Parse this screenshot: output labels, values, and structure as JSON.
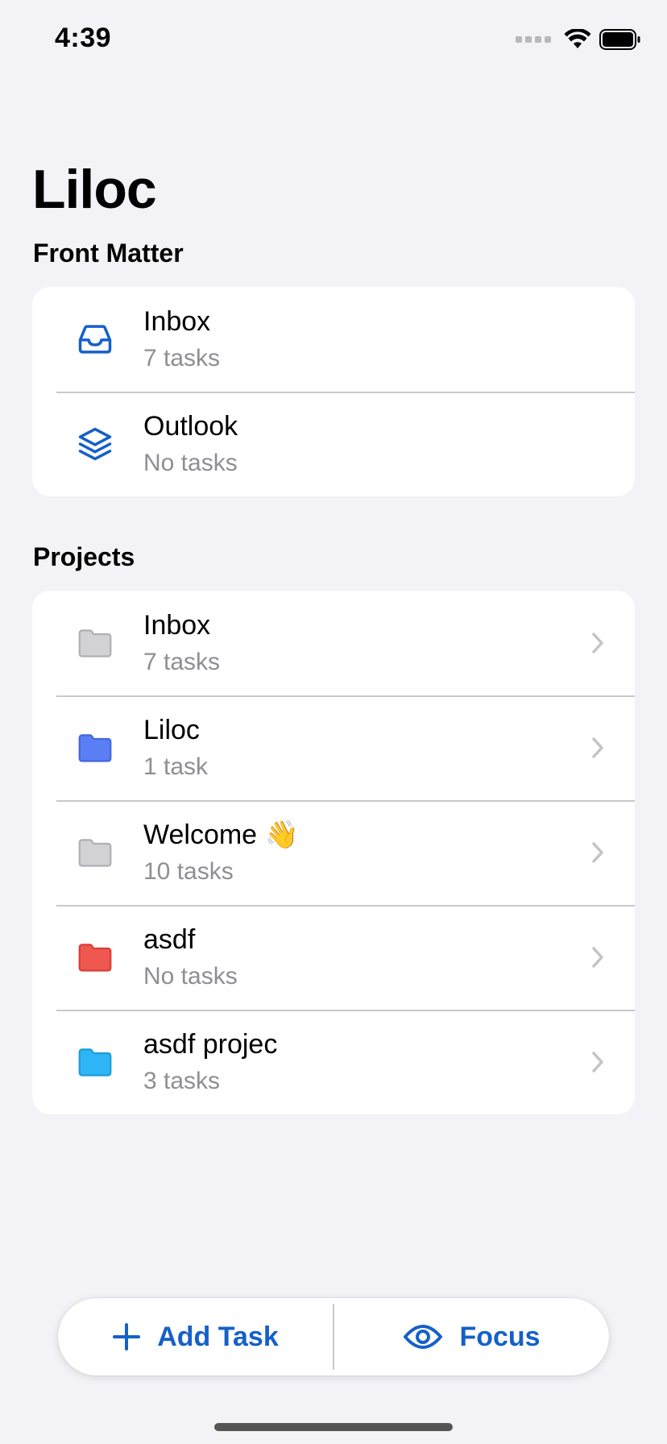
{
  "status_bar": {
    "time": "4:39"
  },
  "app": {
    "title": "Liloc"
  },
  "front_matter": {
    "header": "Front Matter",
    "items": [
      {
        "title": "Inbox",
        "subtitle": "7 tasks",
        "icon": "inbox-tray-icon"
      },
      {
        "title": "Outlook",
        "subtitle": "No tasks",
        "icon": "stack-layers-icon"
      }
    ]
  },
  "projects": {
    "header": "Projects",
    "items": [
      {
        "title": "Inbox",
        "subtitle": "7 tasks",
        "icon": "folder-icon",
        "color": "#d1d1d6"
      },
      {
        "title": "Liloc",
        "subtitle": "1 task",
        "icon": "folder-icon",
        "color": "#5a7ff5"
      },
      {
        "title": "Welcome 👋",
        "subtitle": "10 tasks",
        "icon": "folder-icon",
        "color": "#d1d1d6"
      },
      {
        "title": "asdf",
        "subtitle": "No tasks",
        "icon": "folder-icon",
        "color": "#f0574f"
      },
      {
        "title": "asdf projec",
        "subtitle": "3 tasks",
        "icon": "folder-icon",
        "color": "#2eb5f5"
      }
    ]
  },
  "actions": {
    "add_task_label": "Add Task",
    "focus_label": "Focus"
  },
  "colors": {
    "accent": "#1560c9",
    "background": "#f2f2f7"
  }
}
